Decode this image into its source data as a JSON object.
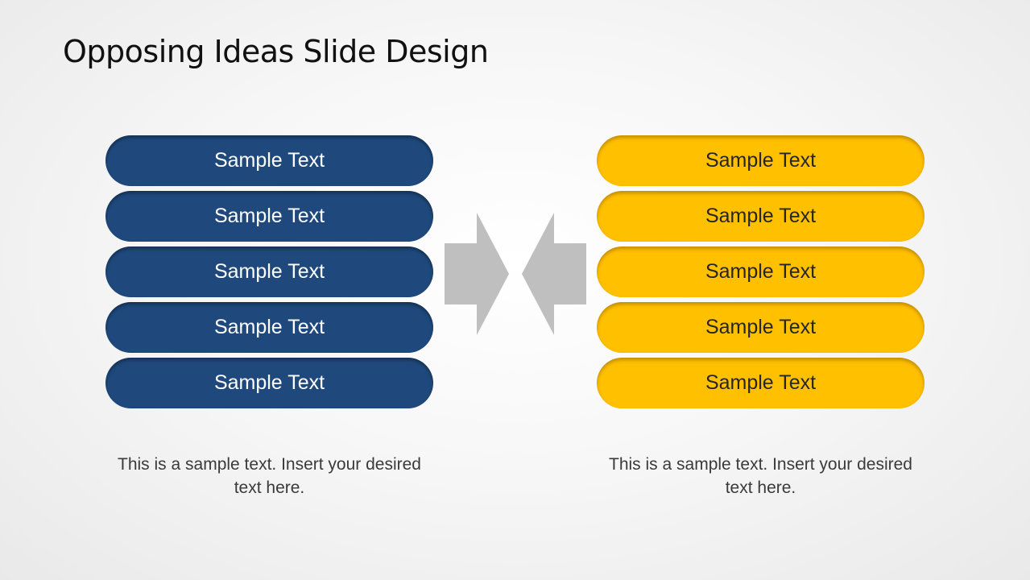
{
  "slide": {
    "title": "Opposing Ideas Slide Design"
  },
  "colors": {
    "left_pill": "#1f497d",
    "right_pill": "#ffc000",
    "arrows": "#bfbfbf"
  },
  "left": {
    "items": [
      "Sample Text",
      "Sample Text",
      "Sample Text",
      "Sample Text",
      "Sample Text"
    ],
    "description": "This is a sample text. Insert your desired text here."
  },
  "right": {
    "items": [
      "Sample Text",
      "Sample Text",
      "Sample Text",
      "Sample Text",
      "Sample Text"
    ],
    "description": "This is a sample text. Insert your desired text here."
  },
  "icons": {
    "left_arrow": "arrow-right-icon",
    "right_arrow": "arrow-left-icon"
  }
}
